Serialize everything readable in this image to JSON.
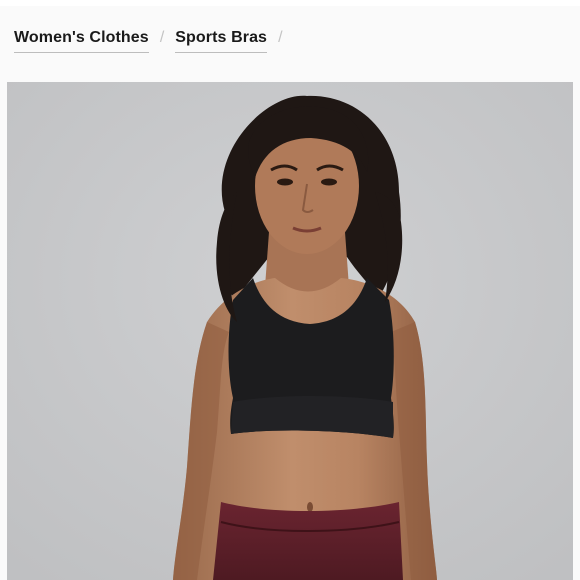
{
  "breadcrumb": {
    "items": [
      {
        "label": "Women's Clothes"
      },
      {
        "label": "Sports Bras"
      }
    ],
    "separator": "/"
  },
  "product_image": {
    "subject": "model wearing black sports bra and burgundy leggings",
    "background_color": "#c9cacc"
  },
  "colors": {
    "breadcrumb_text": "#1a1a1a",
    "separator": "#c4c4c4",
    "bra": "#1c1c1e",
    "leggings": "#5a1f26"
  }
}
